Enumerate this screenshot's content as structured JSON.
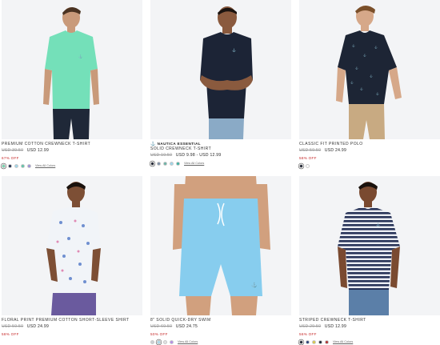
{
  "products": [
    {
      "name": "PREMIUM COTTON CREWNECK T-SHIRT",
      "old_price": "USD 39.50",
      "new_price": "USD 12.99",
      "discount": "67% OFF",
      "swatches": [
        "#6fd6ad",
        "#1c2a4a",
        "#9fd6ea",
        "#5fc3a8",
        "#9b8fd8"
      ],
      "view_all": "View All Colors",
      "shirt_color": "#74e0b9",
      "pants_color": "#1f2838"
    },
    {
      "brand": "NAUTICA ESSENTIAL",
      "name": "SOLID CREWNECK T-SHIRT",
      "old_price": "USD 19.50",
      "new_price": "USD 9.98 - USD 12.99",
      "discount": "",
      "swatches": [
        "#1a1f2e",
        "#7e8fa6",
        "#6bb3a6",
        "#9fd6ea",
        "#3bb0a0"
      ],
      "view_all": "View All Colors",
      "shirt_color": "#1c2436",
      "pants_color": "#8aaac6"
    },
    {
      "name": "CLASSIC FIT PRINTED POLO",
      "old_price": "USD 59.50",
      "new_price": "USD 24.99",
      "discount": "58% OFF",
      "swatches": [
        "#1a1f2e",
        "#ffffff"
      ],
      "view_all": "",
      "shirt_color": "#1d2535",
      "pants_color": "#c8aa82"
    },
    {
      "name": "FLORAL PRINT PREMIUM COTTON SHORT-SLEEVE SHIRT",
      "old_price": "USD 59.50",
      "new_price": "USD 24.99",
      "discount": "58% OFF",
      "swatches": [],
      "view_all": "",
      "shirt_color": "#f1f4f8",
      "pants_color": "#6a5a9e"
    },
    {
      "name": "8\" SOLID QUICK-DRY SWIM",
      "old_price": "USD 69.50",
      "new_price": "USD 24.75",
      "discount": "50% OFF",
      "swatches": [
        "#cdd2d6",
        "#a8dcef",
        "#e3e3e3",
        "#b58ce8"
      ],
      "view_all": "View All Colors",
      "shirt_color": "#87cdee",
      "pants_color": "#87cdee"
    },
    {
      "name": "STRIPED CREWNECK T-SHIRT",
      "old_price": "USD 29.50",
      "new_price": "USD 12.99",
      "discount": "56% OFF",
      "swatches": [
        "#1a1f2e",
        "#2a3f7a",
        "#d9c64a",
        "#1f2838",
        "#b03030"
      ],
      "view_all": "View All Colors",
      "shirt_color": "#243055",
      "pants_color": "#5b7fa8"
    }
  ]
}
